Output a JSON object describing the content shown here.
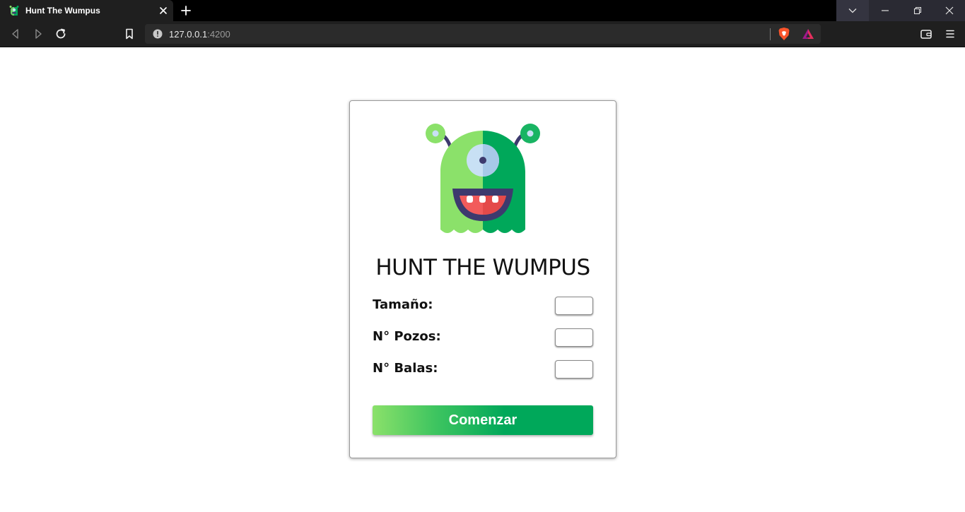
{
  "browser": {
    "tab_title": "Hunt The Wumpus",
    "url_host": "127.0.0.1",
    "url_port": ":4200"
  },
  "game": {
    "title": "HUNT THE WUMPUS",
    "fields": [
      {
        "label": "Tamaño:",
        "value": ""
      },
      {
        "label": "N° Pozos:",
        "value": ""
      },
      {
        "label": "N° Balas:",
        "value": ""
      }
    ],
    "start_label": "Comenzar"
  },
  "colors": {
    "monster_light_green": "#8be16a",
    "monster_dark_green": "#00a85a",
    "monster_purple": "#3d3a6e",
    "mouth_red": "#f25b5b",
    "eye_blue": "#c8e0f4"
  }
}
